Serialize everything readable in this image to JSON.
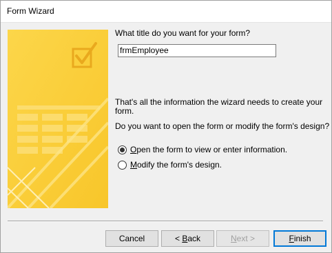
{
  "window": {
    "title": "Form Wizard"
  },
  "prompt": {
    "title_question": "What title do you want for your form?"
  },
  "form_title_input": {
    "value": "frmEmployee"
  },
  "info": {
    "line1": "That's all the information the wizard needs to create your",
    "line2": "form.",
    "question": "Do you want to open the form or modify the form's design?"
  },
  "options": [
    {
      "accel": "O",
      "rest": "pen the form to view or enter information.",
      "checked": true
    },
    {
      "accel": "M",
      "rest": "odify the form's design.",
      "checked": false
    }
  ],
  "buttons": {
    "cancel": "Cancel",
    "back_prefix": "< ",
    "back_accel": "B",
    "back_rest": "ack",
    "next_accel": "N",
    "next_rest": "ext >",
    "finish_accel": "F",
    "finish_rest": "inish"
  },
  "colors": {
    "art_yellow": "#fbd23c",
    "art_light": "#fde68a",
    "default_button_border": "#0078d7"
  }
}
